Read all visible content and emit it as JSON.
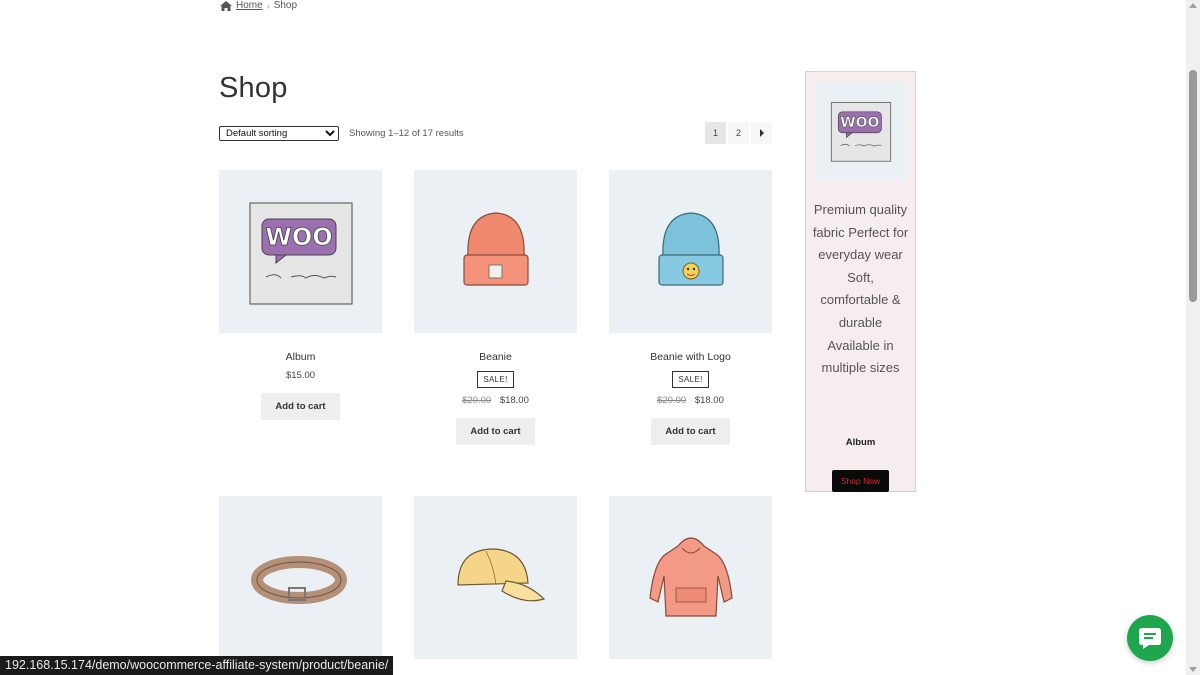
{
  "breadcrumb": {
    "home": "Home",
    "current": "Shop"
  },
  "page_title": "Shop",
  "sorting": {
    "selected": "Default sorting"
  },
  "result_count": "Showing 1–12 of 17 results",
  "pagination": {
    "pages": [
      "1",
      "2"
    ],
    "current": "1"
  },
  "products": [
    {
      "name": "Album",
      "price": "$15.00",
      "cart_label": "Add to cart"
    },
    {
      "name": "Beanie",
      "sale_badge": "SALE!",
      "old_price": "$20.00",
      "price": "$18.00",
      "cart_label": "Add to cart"
    },
    {
      "name": "Beanie with Logo",
      "sale_badge": "SALE!",
      "old_price": "$20.00",
      "price": "$18.00",
      "cart_label": "Add to cart"
    },
    {
      "name": ""
    },
    {
      "name": ""
    },
    {
      "name": ""
    }
  ],
  "product_icons": [
    "album-image",
    "beanie-image",
    "beanie-with-logo-image",
    "belt-image",
    "cap-image",
    "hoodie-image"
  ],
  "ad": {
    "description": "Premium quality fabric Perfect for everyday wear Soft, comfortable & durable Available in multiple sizes",
    "title": "Album",
    "button": "Shop Now",
    "button_text_color": "#e0262a"
  },
  "status_url": "192.168.15.174/demo/woocommerce-affiliate-system/product/beanie/",
  "colors": {
    "thumb_bg": "#eaf0f3",
    "ad_bg": "#f6eeee",
    "chat_green": "#1ea64f",
    "woo_purple": "#9b6fb0"
  }
}
